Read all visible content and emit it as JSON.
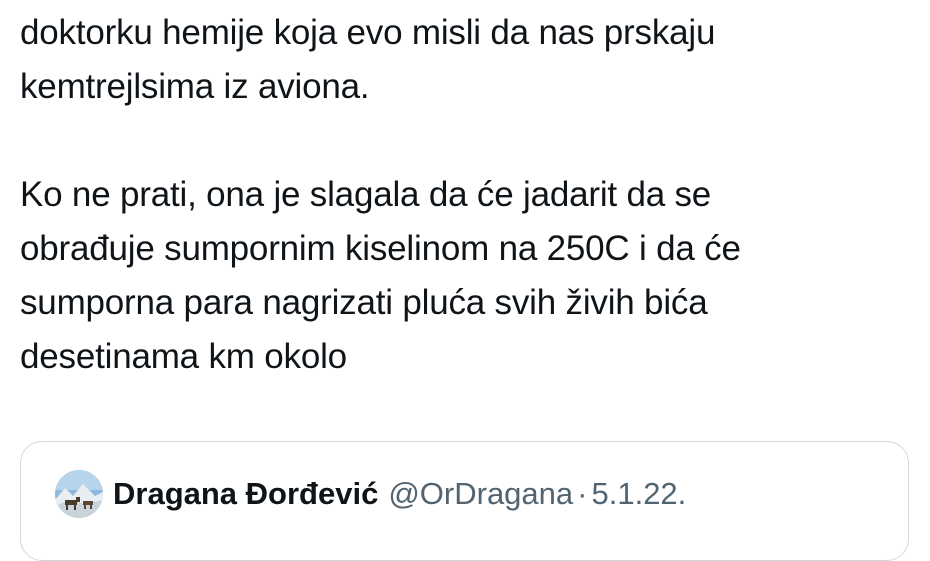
{
  "tweet": {
    "lines": [
      "doktorku hemije koja evo misli da nas prskaju",
      "kemtrejlsima iz aviona.",
      "Ko ne prati, ona je slagala da će jadarit da se",
      "obrađuje sumpornim kiselinom na 250C i da će",
      "sumporna para nagrizati pluća svih živih bića",
      "desetinama km okolo"
    ]
  },
  "quoted_tweet": {
    "author_name": "Dragana Đorđević",
    "handle": "@OrDragana",
    "separator": "·",
    "date": "5.1.22."
  },
  "colors": {
    "text_primary": "#0f1419",
    "text_secondary": "#536471",
    "card_border": "#cfd9de"
  }
}
